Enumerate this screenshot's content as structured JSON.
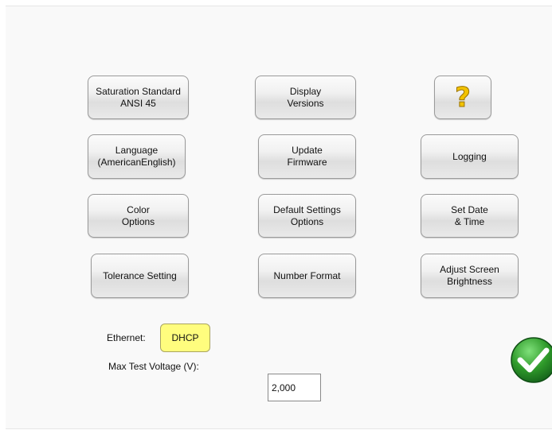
{
  "buttons": {
    "saturation": [
      "Saturation Standard",
      "ANSI 45"
    ],
    "display_versions": [
      "Display",
      "Versions"
    ],
    "help": "?",
    "language": [
      "Language",
      "(AmericanEnglish)"
    ],
    "update_firmware": [
      "Update",
      "Firmware"
    ],
    "logging": "Logging",
    "color_options": [
      "Color",
      "Options"
    ],
    "default_settings": [
      "Default Settings",
      "Options"
    ],
    "set_date_time": [
      "Set Date",
      "& Time"
    ],
    "tolerance": "Tolerance Setting",
    "number_format": "Number Format",
    "brightness": [
      "Adjust Screen",
      "Brightness"
    ]
  },
  "ethernet": {
    "label": "Ethernet:",
    "value": "DHCP"
  },
  "max_voltage": {
    "label": "Max Test Voltage (V):",
    "value": "2,000"
  },
  "icons": {
    "help": "question-mark-icon",
    "ok": "checkmark-icon"
  },
  "colors": {
    "dhcp_bg": "#fffd7e",
    "ok_green": "#2f9a2a"
  }
}
